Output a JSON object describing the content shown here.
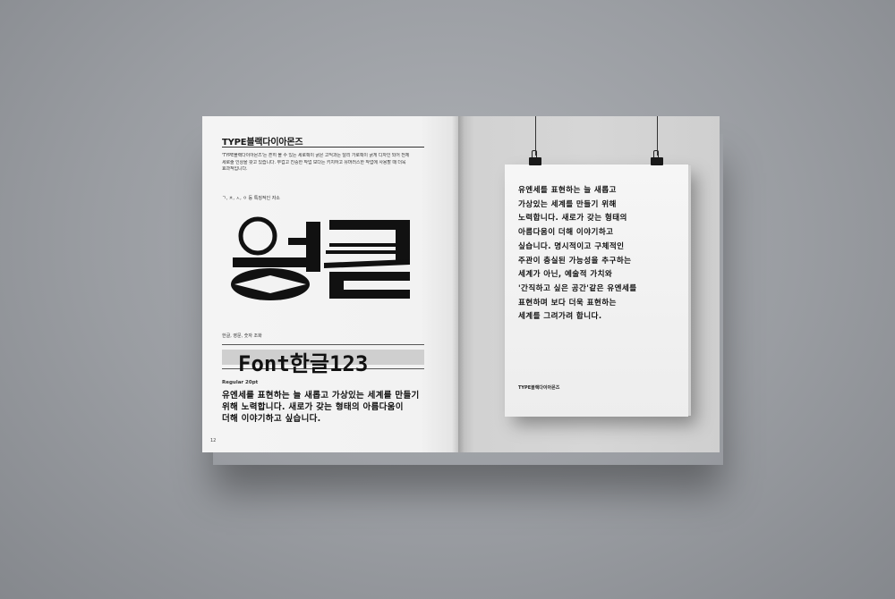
{
  "left_page": {
    "title": "TYPE블랙다이아몬즈",
    "intro_lines": [
      "'TYPE블랙다이아몬즈'는 흔히 볼 수 있는 세로획이 굵은 고딕과는 달리 가로획이 굵게 디자인 되어 전체",
      "세로줄 인상을 갖고 있습니다. 무겁고 진중한 작업 보다는 키치하고 유머러스한 작업에 사용할 때 더욱",
      "효과적입니다."
    ],
    "char_note": "ㄱ, ㅊ, ㅅ, ㅇ 등 특징적인 자소",
    "combo_label": "한글, 영문, 숫자 조화",
    "combo_text": "Font한글123",
    "weight_label": "Regular 20pt",
    "sample_lines": [
      "유엔세를 표현하는 늘 새롭고 가상있는 세계를 만들기",
      "위해 노력합니다. 새로가 갖는 형태의 아름다움이",
      "더해 이야기하고 싶습니다."
    ],
    "page_number": "12"
  },
  "poster": {
    "lines": [
      "유엔세를 표현하는 늘 새롭고",
      "가상있는 세계를 만들기 위해",
      "노력합니다. 새로가 갖는 형태의",
      "아름다움이 더해 이야기하고",
      "싶습니다. 명시적이고 구체적인",
      "주관이 충실된 가능성을 추구하는",
      "세계가 아닌, 예술적 가치와",
      "'간직하고 싶은 공간'같은 유엔세를",
      "표현하며 보다 더욱 표현하는",
      "세계를 그려가려 합니다."
    ],
    "label": "TYPE블랙다이아몬즈"
  },
  "colors": {
    "background": "#9a9da2",
    "paper": "#f2f2f2",
    "ink": "#111111"
  }
}
